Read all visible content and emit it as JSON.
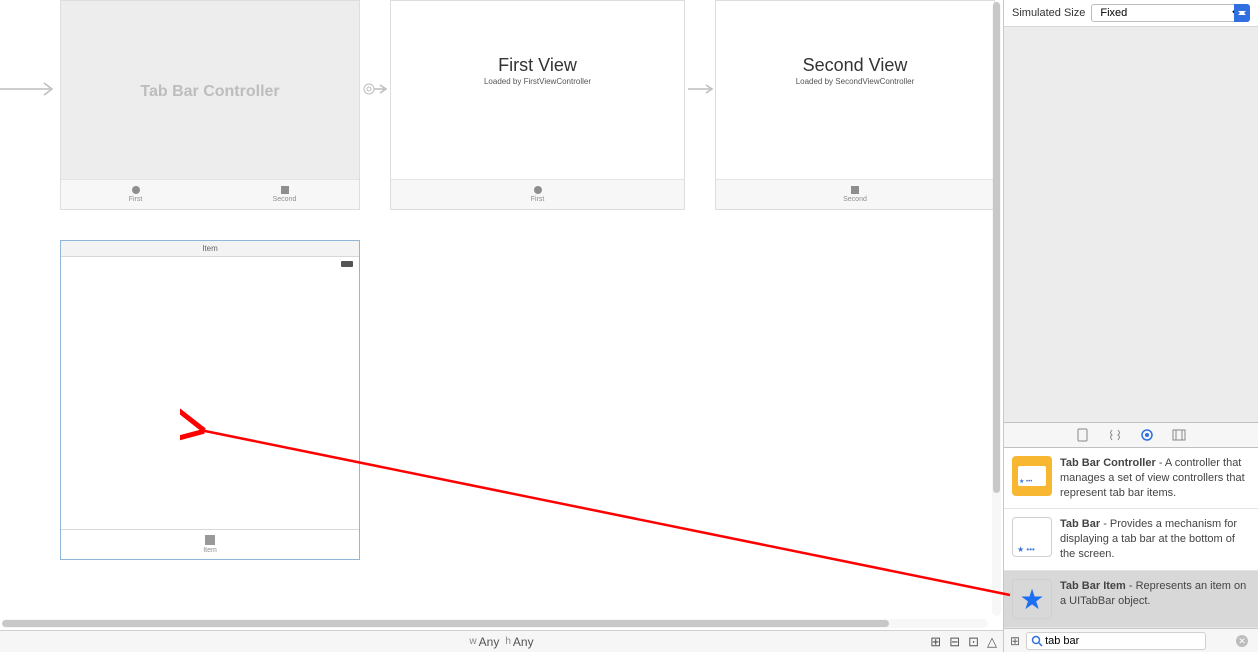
{
  "canvas": {
    "scenes": {
      "tabctrl": {
        "title": "Tab Bar Controller",
        "tabs": [
          {
            "label": "First"
          },
          {
            "label": "Second"
          }
        ]
      },
      "first": {
        "title": "First View",
        "subtitle": "Loaded by FirstViewController",
        "tab": "First"
      },
      "second": {
        "title": "Second View",
        "subtitle": "Loaded by SecondViewController",
        "tab": "Second"
      },
      "item": {
        "header": "Item",
        "tab": "Item"
      }
    },
    "sizeclass": {
      "w_label": "w",
      "w": "Any",
      "h_label": "h",
      "h": "Any"
    }
  },
  "inspector": {
    "simulated_size_label": "Simulated Size",
    "simulated_size_value": "Fixed",
    "library": [
      {
        "title": "Tab Bar Controller",
        "desc": " - A controller that manages a set of view controllers that represent tab bar items."
      },
      {
        "title": "Tab Bar",
        "desc": " - Provides a mechanism for displaying a tab bar at the bottom of the screen."
      },
      {
        "title": "Tab Bar Item",
        "desc": " - Represents an item on a UITabBar object."
      }
    ],
    "search_value": "tab bar"
  }
}
